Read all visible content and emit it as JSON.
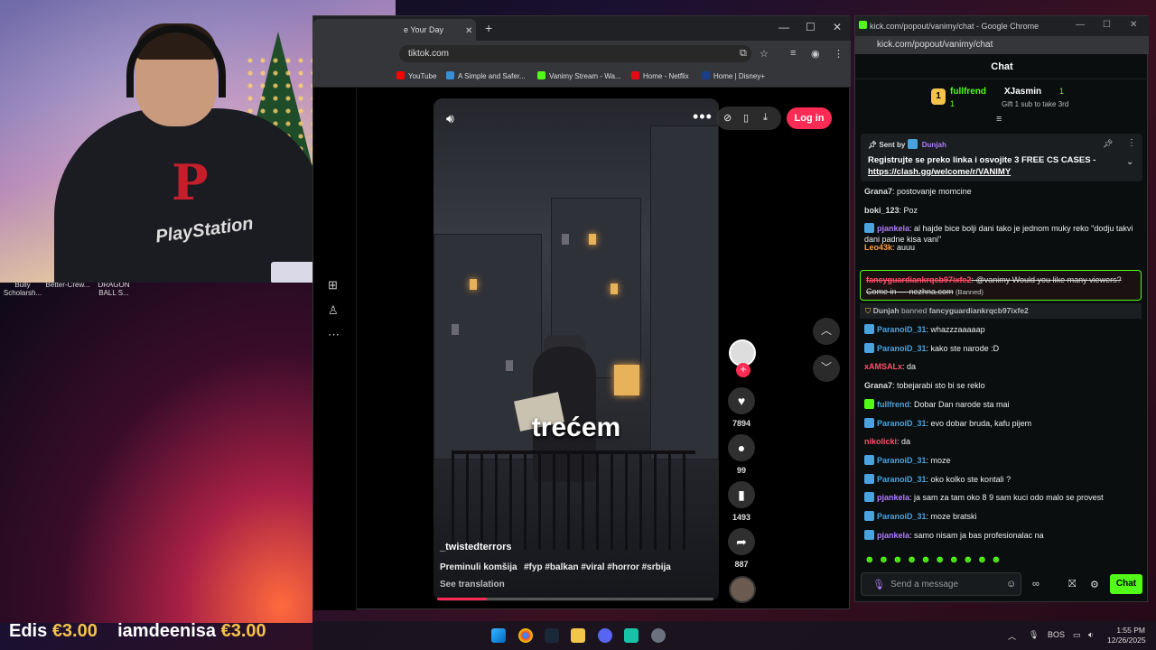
{
  "desktop": {
    "icons": [
      {
        "label": "Bully Scholarsh..."
      },
      {
        "label": "Better-Crew..."
      },
      {
        "label": "DRAGON BALL S..."
      }
    ]
  },
  "webcam": {
    "brand_text": "PlayStation"
  },
  "browser": {
    "tab_title": "e Your Day",
    "url": "tiktok.com",
    "bookmarks": [
      "YouTube",
      "A Simple and Safer...",
      "Vanimy Stream - Wa...",
      "Home - Netflix",
      "Home | Disney+"
    ],
    "login_label": "Log in",
    "video": {
      "caption": "trećem",
      "author": "_twistedterrors",
      "description": "Preminuli komšija",
      "tags": "#fyp #balkan #viral #horror #srbija",
      "see_translation": "See translation",
      "likes": "7894",
      "comments": "99",
      "saves": "1493",
      "shares": "887",
      "progress": 0.18
    }
  },
  "chat": {
    "window_title": "kick.com/popout/vanimy/chat - Google Chrome",
    "url": "kick.com/popout/vanimy/chat",
    "header": "Chat",
    "leaderboard": {
      "first_user": "fullfrend",
      "first_count": "1",
      "second_user": "XJasmin",
      "second_count": "1",
      "gift_note": "Gift 1 sub to take 3rd"
    },
    "pinned": {
      "sent_by_label": "Sent by",
      "sent_by_user": "Dunjah",
      "message": "Registrujte se preko linka i osvojite 3 FREE CS CASES",
      "link": "https://clash.gg/welcome/r/VANIMY"
    },
    "messages": [
      {
        "user": "Grana7",
        "text": ": postovanje momcine",
        "color": "#dddddd"
      },
      {
        "user": "boki_123",
        "text": ": Poz",
        "color": "#dddddd"
      },
      {
        "user": "pjankela",
        "text": ": al hajde bice bolji dani tako je jednom muky reko \"dodju takvi dani padne kisa vani\"",
        "color": "#b07cff"
      },
      {
        "user": "Leo43k",
        "text": ": auuu",
        "color": "#ff9c3a"
      }
    ],
    "flagged": {
      "user": "fancyguardiankrqcb97ixfe2",
      "text": ": @vanimy Would you like many viewers? Come in — nezhna.com",
      "tag": "(Banned)"
    },
    "ban_note": {
      "actor": "Dunjah",
      "verb": "banned",
      "target": "fancyguardiankrqcb97ixfe2"
    },
    "messages2": [
      {
        "user": "ParanoiD_31",
        "text": ": whazzzaaaaap",
        "color": "#4aa3df"
      },
      {
        "user": "ParanoiD_31",
        "text": ": kako ste narode :D",
        "color": "#4aa3df"
      },
      {
        "user": "xAMSALx",
        "text": ": da",
        "color": "#ff4f6a"
      },
      {
        "user": "Grana7",
        "text": ": tobejarabi sto bi se reklo",
        "color": "#dddddd"
      },
      {
        "user": "fullfrend",
        "text": ": Dobar Dan narode sta mai",
        "color": "#4aa3df"
      },
      {
        "user": "ParanoiD_31",
        "text": ": evo dobar bruda, kafu pijem",
        "color": "#4aa3df"
      },
      {
        "user": "nikolicki",
        "text": ": da",
        "color": "#ff4f6a"
      },
      {
        "user": "ParanoiD_31",
        "text": ": moze",
        "color": "#4aa3df"
      },
      {
        "user": "ParanoiD_31",
        "text": ": oko kolko ste kontali ?",
        "color": "#4aa3df"
      },
      {
        "user": "pjankela",
        "text": ": ja sam za tam oko 8 9 sam kuci odo malo se provest",
        "color": "#b07cff"
      },
      {
        "user": "ParanoiD_31",
        "text": ": moze bratski",
        "color": "#4aa3df"
      },
      {
        "user": "pjankela",
        "text": ": samo nisam ja bas profesionalac na",
        "color": "#b07cff"
      }
    ],
    "input_placeholder": "Send a message",
    "send_label": "Chat"
  },
  "donations": [
    {
      "name": "Edis",
      "amount": "€3.00"
    },
    {
      "name": "iamdeenisa",
      "amount": "€3.00"
    }
  ],
  "taskbar": {
    "lang": "BOS",
    "time": "1:55 PM",
    "date": "12/26/2025"
  },
  "colors": {
    "kick_green": "#53fc18",
    "tiktok_red": "#fe2c55"
  }
}
